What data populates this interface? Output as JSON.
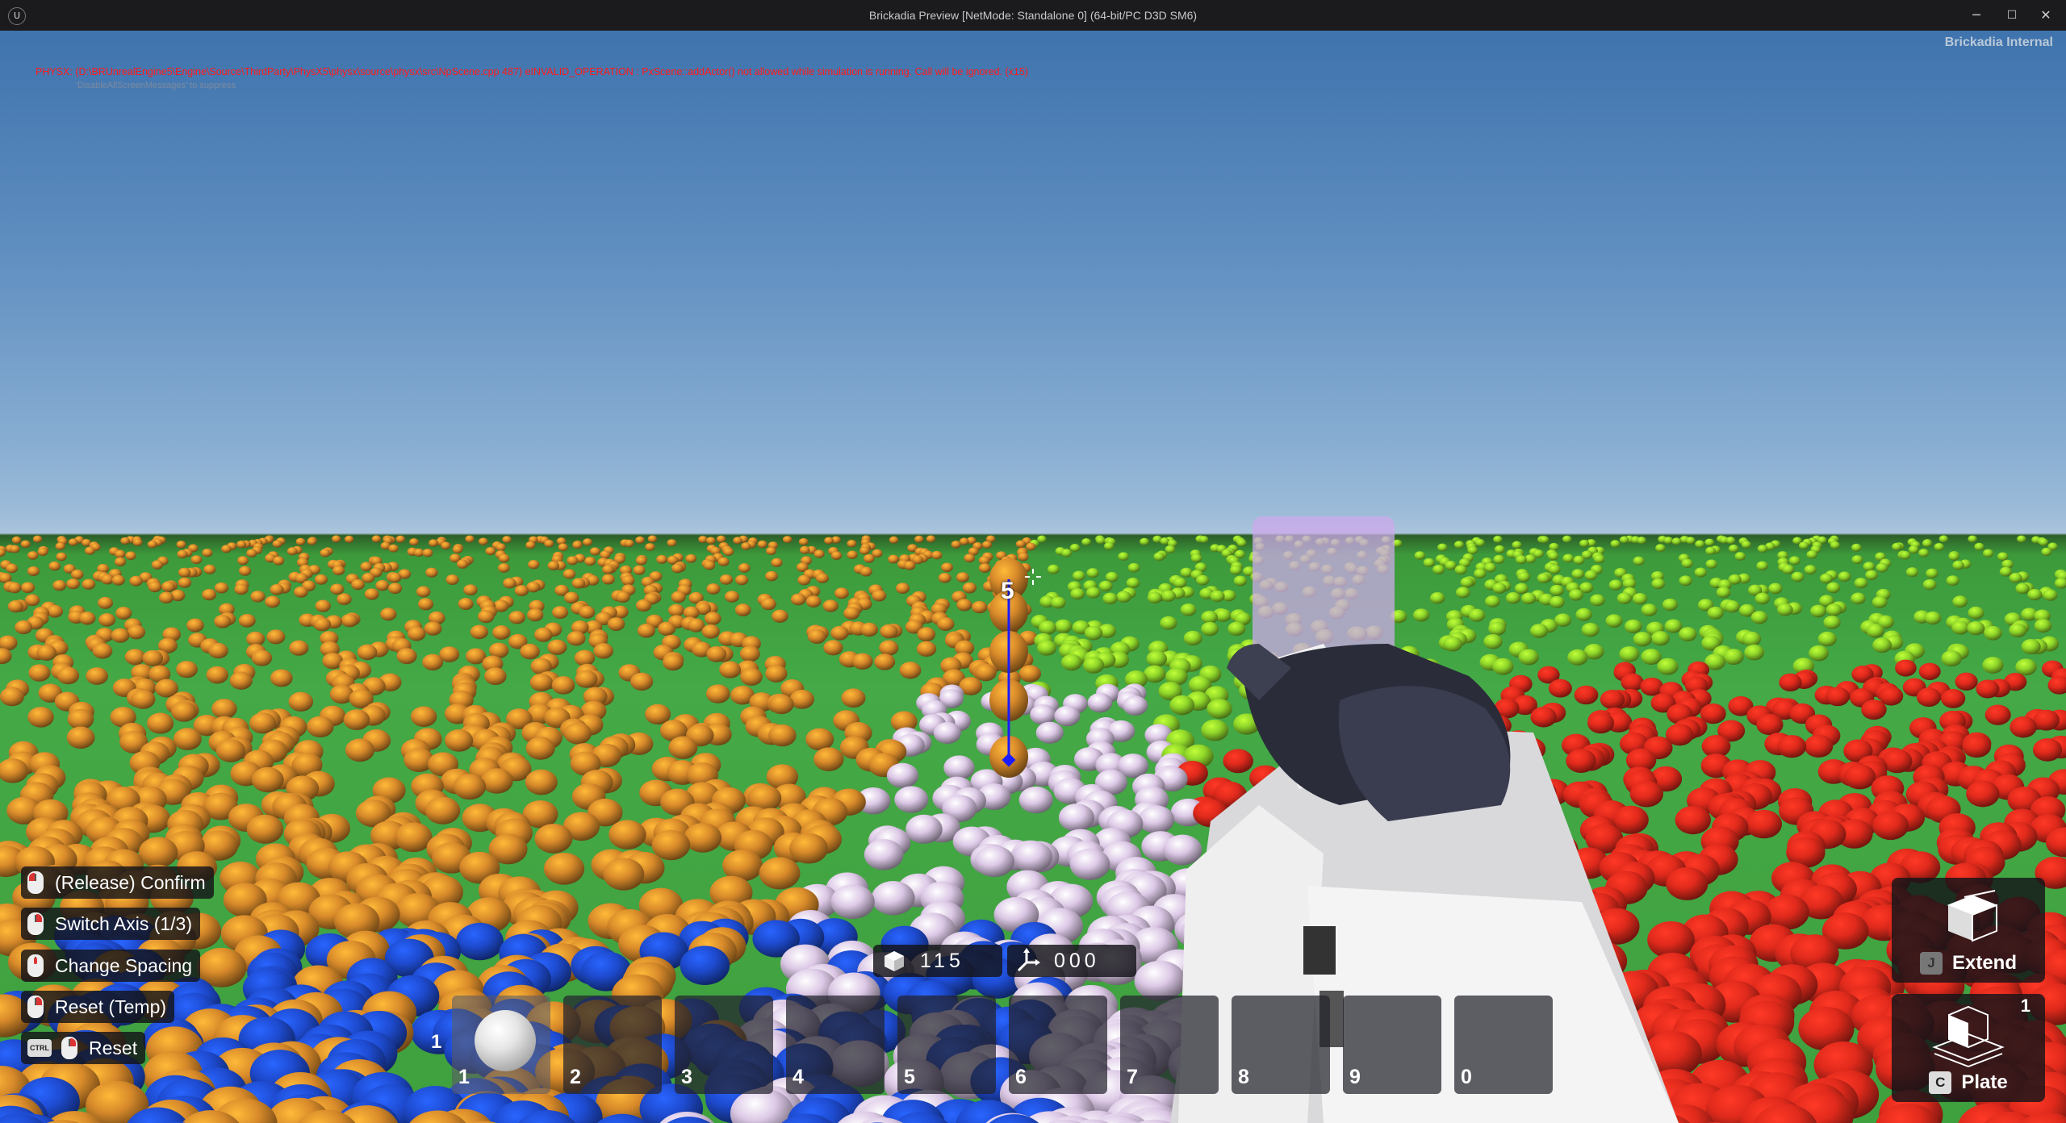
{
  "window": {
    "title": "Brickadia Preview [NetMode: Standalone 0]  (64-bit/PC D3D SM6)",
    "logo_glyph": "U",
    "minimize_glyph": "─",
    "maximize_glyph": "☐",
    "close_glyph": "✕"
  },
  "overlay": {
    "error_message": "PHYSX: (D:\\BRUnrealEngine5\\Engine\\Source\\ThirdParty\\PhysX5\\physx\\source\\physx\\src\\NpScene.cpp 487) eINVALID_OPERATION : PxScene::addActor() not allowed while simulation is running. Call will be ignored. (x15)",
    "suppress_hint": "'DisableAllScreenMessages' to suppress",
    "build_label": "Brickadia Internal"
  },
  "placement": {
    "stack_count": "5"
  },
  "actions": [
    {
      "icon": "mouse-left-icon",
      "label": "(Release) Confirm"
    },
    {
      "icon": "mouse-right-icon",
      "label": "Switch Axis (1/3)"
    },
    {
      "icon": "mouse-wheel-icon",
      "label": "Change Spacing"
    },
    {
      "icon": "mouse-right-icon",
      "label": "Reset (Temp)"
    },
    {
      "icon": "ctrl-key-icon",
      "modifier": "CTRL",
      "icon2": "mouse-right-icon",
      "label": "Reset"
    }
  ],
  "counters": {
    "brick_count": "115",
    "offset": "000"
  },
  "hotbar": {
    "selected_page": "1",
    "slots": [
      "1",
      "2",
      "3",
      "4",
      "5",
      "6",
      "7",
      "8",
      "9",
      "0"
    ]
  },
  "modes": {
    "extend": {
      "key": "J",
      "label": "Extend"
    },
    "plate": {
      "key": "C",
      "label": "Plate",
      "count": "1"
    }
  },
  "colors": {
    "ground": "#44a946",
    "sky": "#5f8ec0",
    "orange_bricks": "#d88a2a",
    "lavender_bricks": "#dcc8e6",
    "red_bricks": "#e02a1c",
    "lime_bricks": "#8fd62a",
    "blue_bricks": "#1e4bd0"
  }
}
